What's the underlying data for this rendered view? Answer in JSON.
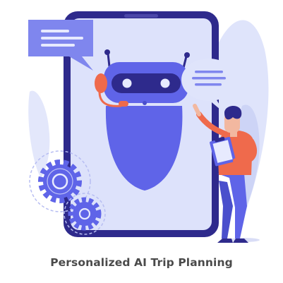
{
  "caption": "Personalized AI Trip Planning",
  "colors": {
    "phone_frame": "#2e2a8c",
    "phone_screen": "#dde2fb",
    "robot_body": "#5f64e8",
    "robot_visor": "#2e2a8c",
    "robot_accent": "#ef6a4c",
    "speech_bubble": "#7f86ee",
    "speech_bubble_light": "#dfe4fb",
    "foliage": "#dfe4fb",
    "person_shirt": "#ef6a4c",
    "person_pants": "#5f64e8",
    "gear": "#5f64e8",
    "caption_text": "#4a4a4a"
  },
  "icons": [
    "smartphone-icon",
    "chatbot-robot-icon",
    "speech-bubble-icon",
    "gear-icon",
    "person-with-clipboard-icon"
  ]
}
